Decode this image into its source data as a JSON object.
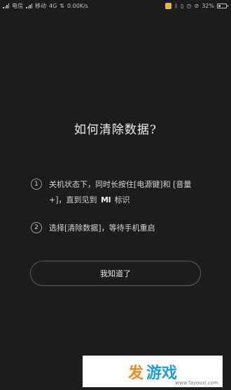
{
  "status_bar": {
    "carrier1": "电信",
    "carrier2": "移动",
    "network": "4G",
    "speed": "0.00K/s",
    "battery": "32%",
    "battery_level": 0.32
  },
  "dialog": {
    "title": "如何清除数据?",
    "steps": [
      {
        "num": "1",
        "text_a": "关机状态下，同时长按住[电源键]和 [音量+]，直到见到",
        "logo": "MI",
        "text_b": "标识"
      },
      {
        "num": "2",
        "text": "选择[清除数据]，等待手机重启"
      }
    ],
    "ok_button": "我知道了"
  },
  "watermark": {
    "char1": "发",
    "char2": "游戏",
    "url": "www.fayouxi.com"
  },
  "colors": {
    "background": "#1c1c1c",
    "watermark_orange": "#ef8a1f",
    "watermark_blue": "#1f9be0"
  }
}
